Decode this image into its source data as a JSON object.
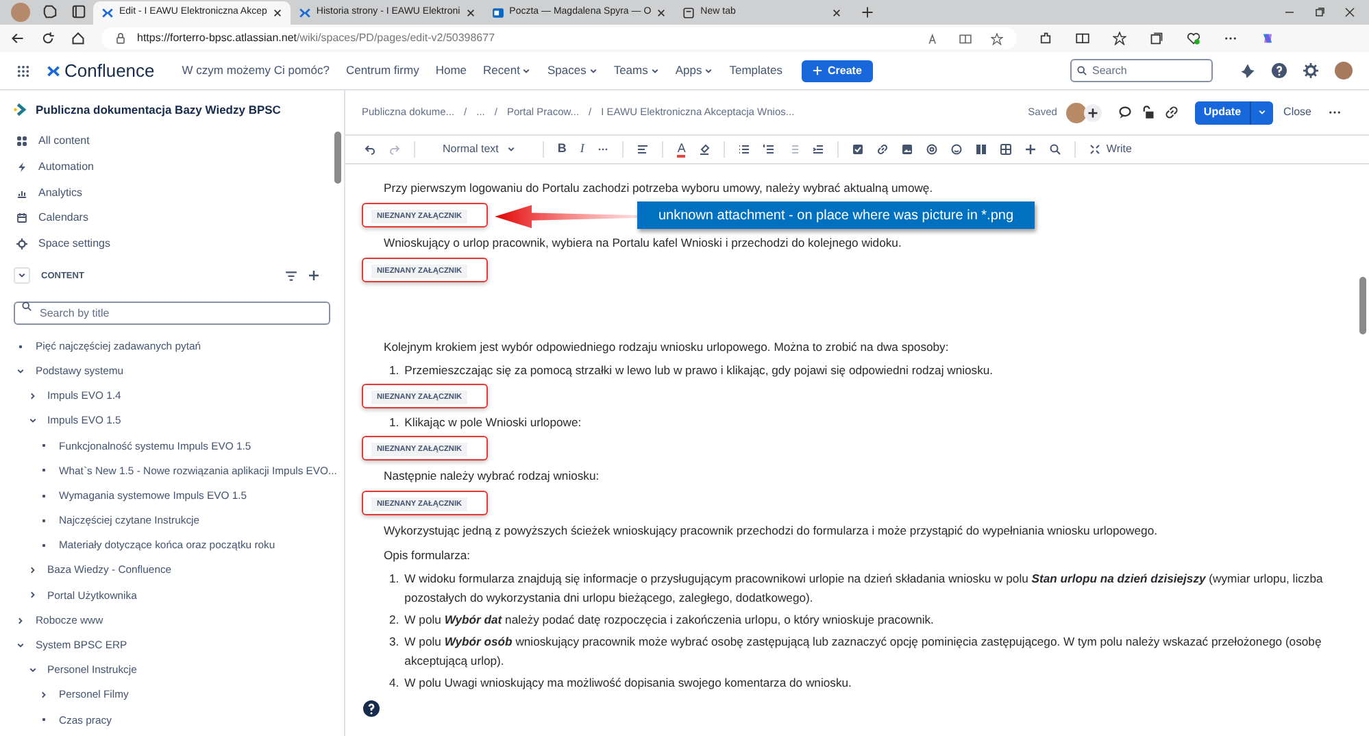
{
  "browser": {
    "tabs": [
      {
        "title": "Edit - I EAWU Elektroniczna Akcep",
        "selected": true
      },
      {
        "title": "Historia strony - I EAWU Elektroni",
        "selected": false
      },
      {
        "title": "Poczta — Magdalena Spyra — O",
        "selected": false
      },
      {
        "title": "New tab",
        "selected": false
      }
    ],
    "url_host": "https://forterro-bpsc.atlassian.net",
    "url_path": "/wiki/spaces/PD/pages/edit-v2/50398677"
  },
  "nav": {
    "product": "Confluence",
    "items": [
      {
        "label": "W czym możemy Ci pomóc?",
        "dropdown": false
      },
      {
        "label": "Centrum firmy",
        "dropdown": false
      },
      {
        "label": "Home",
        "dropdown": false
      },
      {
        "label": "Recent",
        "dropdown": true
      },
      {
        "label": "Spaces",
        "dropdown": true
      },
      {
        "label": "Teams",
        "dropdown": true
      },
      {
        "label": "Apps",
        "dropdown": true
      },
      {
        "label": "Templates",
        "dropdown": false
      }
    ],
    "create": "Create",
    "search_placeholder": "Search"
  },
  "sidebar": {
    "space": "Publiczna dokumentacja Bazy Wiedzy BPSC",
    "links": [
      {
        "label": "All content"
      },
      {
        "label": "Automation"
      },
      {
        "label": "Analytics"
      },
      {
        "label": "Calendars"
      },
      {
        "label": "Space settings"
      }
    ],
    "section": "CONTENT",
    "section_expanded": true,
    "search_placeholder": "Search by title",
    "tree": [
      {
        "label": "Pięć najczęściej zadawanych pytań",
        "kind": "page"
      },
      {
        "label": "Podstawy systemu",
        "kind": "folder",
        "expanded": true,
        "children": [
          {
            "label": "Impuls EVO 1.4",
            "kind": "folder",
            "expanded": false
          },
          {
            "label": "Impuls EVO 1.5",
            "kind": "folder",
            "expanded": true,
            "children": [
              {
                "label": "Funkcjonalność systemu Impuls EVO 1.5",
                "kind": "page"
              },
              {
                "label": "What`s New 1.5 - Nowe rozwiązania aplikacji Impuls EVO...",
                "kind": "page"
              },
              {
                "label": "Wymagania systemowe Impuls EVO 1.5",
                "kind": "page"
              },
              {
                "label": "Najczęściej czytane Instrukcje",
                "kind": "page"
              },
              {
                "label": "Materiały dotyczące końca oraz początku roku",
                "kind": "page"
              }
            ]
          },
          {
            "label": "Baza Wiedzy - Confluence",
            "kind": "folder",
            "expanded": false
          },
          {
            "label": "Portal Użytkownika",
            "kind": "folder",
            "expanded": false
          }
        ]
      },
      {
        "label": "Robocze www",
        "kind": "folder",
        "expanded": false
      },
      {
        "label": "System BPSC ERP",
        "kind": "folder",
        "expanded": true,
        "children": [
          {
            "label": "Personel Instrukcje",
            "kind": "folder",
            "expanded": true,
            "children": [
              {
                "label": "Personel Filmy",
                "kind": "folder",
                "expanded": false
              },
              {
                "label": "Czas pracy",
                "kind": "page"
              }
            ]
          }
        ]
      }
    ]
  },
  "page_header": {
    "separator": "/",
    "breadcrumbs": [
      "Publiczna dokume...",
      "...",
      "Portal Pracow...",
      "I EAWU Elektroniczna Akceptacja Wnios..."
    ],
    "status": "Saved",
    "update": "Update",
    "close": "Close"
  },
  "toolbar": {
    "style": "Normal text",
    "bold": "B",
    "italic": "I",
    "text_color": "A",
    "write": "Write"
  },
  "content": [
    {
      "kind": "paragraph",
      "text": "Przy pierwszym logowaniu do Portalu zachodzi potrzeba wyboru umowy, należy wybrać aktualną umowę."
    },
    {
      "kind": "attachment",
      "text": "NIEZNANY ZAŁĄCZNIK",
      "highlighted": true
    },
    {
      "kind": "paragraph",
      "text": "Wnioskujący o urlop pracownik, wybiera na Portalu kafel Wnioski i przechodzi do kolejnego widoku."
    },
    {
      "kind": "attachment",
      "text": "NIEZNANY ZAŁĄCZNIK",
      "highlighted": true
    },
    {
      "kind": "spacer"
    },
    {
      "kind": "paragraph",
      "text": "Kolejnym krokiem jest wybór odpowiedniego rodzaju wniosku urlopowego. Można to zrobić na dwa sposoby:"
    },
    {
      "kind": "list_item",
      "number": "1.",
      "text": "Przemieszczając się za pomocą strzałki w lewo lub w prawo i klikając, gdy pojawi się odpowiedni rodzaj wniosku."
    },
    {
      "kind": "attachment",
      "text": "NIEZNANY ZAŁĄCZNIK",
      "highlighted": true
    },
    {
      "kind": "list_item",
      "number": "1.",
      "text": "Klikając w pole Wnioski urlopowe:"
    },
    {
      "kind": "attachment",
      "text": "NIEZNANY ZAŁĄCZNIK",
      "highlighted": true
    },
    {
      "kind": "paragraph",
      "text": "Następnie należy wybrać rodzaj wniosku:"
    },
    {
      "kind": "attachment",
      "text": "NIEZNANY ZAŁĄCZNIK",
      "highlighted": true
    },
    {
      "kind": "paragraph",
      "text": "Wykorzystując jedną z powyższych ścieżek wnioskujący pracownik przechodzi do formularza i może przystąpić do wypełniania wniosku urlopowego."
    },
    {
      "kind": "paragraph",
      "text": "Opis formularza:"
    },
    {
      "kind": "list_item",
      "number": "1.",
      "text": "W widoku formularza znajdują się informacje o przysługującym pracownikowi urlopie na dzień składania wniosku w polu **Stan urlopu na dzień dzisiejszy** (wymiar urlopu, liczba pozostałych do wykorzystania dni urlopu bieżącego, zaległego, dodatkowego)."
    },
    {
      "kind": "list_item",
      "number": "2.",
      "text": "W polu **Wybór dat** należy podać datę rozpoczęcia i zakończenia urlopu, o który wnioskuje pracownik."
    },
    {
      "kind": "list_item",
      "number": "3.",
      "text": "W polu **Wybór osób** wnioskujący pracownik może wybrać osobę zastępującą lub zaznaczyć opcję pominięcia zastępującego. W tym polu należy wskazać przełożonego (osobę akceptującą urlop)."
    },
    {
      "kind": "list_item",
      "number": "4.",
      "text": "W polu Uwagi wnioskujący ma możliwość dopisania swojego komentarza do wniosku."
    }
  ],
  "callout": {
    "text": "unknown attachment - on place where was picture in *.png"
  }
}
